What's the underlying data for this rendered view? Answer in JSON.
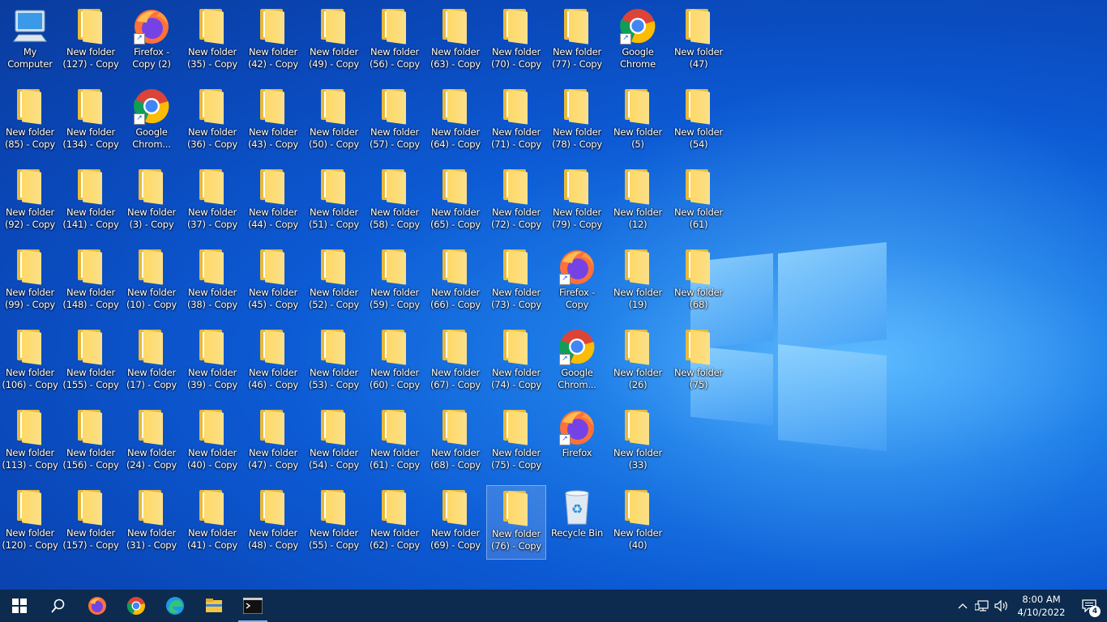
{
  "desktop": {
    "columns": [
      [
        {
          "label": "My\nComputer",
          "type": "computer"
        },
        {
          "label": "New folder\n(85) - Copy",
          "type": "folder"
        },
        {
          "label": "New folder\n(92) - Copy",
          "type": "folder"
        },
        {
          "label": "New folder\n(99) - Copy",
          "type": "folder"
        },
        {
          "label": "New folder\n(106) - Copy",
          "type": "folder"
        },
        {
          "label": "New folder\n(113) - Copy",
          "type": "folder"
        },
        {
          "label": "New folder\n(120) - Copy",
          "type": "folder"
        }
      ],
      [
        {
          "label": "New folder\n(127) - Copy",
          "type": "folder"
        },
        {
          "label": "New folder\n(134) - Copy",
          "type": "folder"
        },
        {
          "label": "New folder\n(141) - Copy",
          "type": "folder"
        },
        {
          "label": "New folder\n(148) - Copy",
          "type": "folder"
        },
        {
          "label": "New folder\n(155) - Copy",
          "type": "folder"
        },
        {
          "label": "New folder\n(156) - Copy",
          "type": "folder"
        },
        {
          "label": "New folder\n(157) - Copy",
          "type": "folder"
        }
      ],
      [
        {
          "label": "Firefox -\nCopy (2)",
          "type": "firefox"
        },
        {
          "label": "Google\nChrom...",
          "type": "chrome"
        },
        {
          "label": "New folder\n(3) - Copy",
          "type": "folder"
        },
        {
          "label": "New folder\n(10) - Copy",
          "type": "folder"
        },
        {
          "label": "New folder\n(17) - Copy",
          "type": "folder"
        },
        {
          "label": "New folder\n(24) - Copy",
          "type": "folder"
        },
        {
          "label": "New folder\n(31) - Copy",
          "type": "folder"
        }
      ],
      [
        {
          "label": "New folder\n(35) - Copy",
          "type": "folder"
        },
        {
          "label": "New folder\n(36) - Copy",
          "type": "folder"
        },
        {
          "label": "New folder\n(37) - Copy",
          "type": "folder"
        },
        {
          "label": "New folder\n(38) - Copy",
          "type": "folder"
        },
        {
          "label": "New folder\n(39) - Copy",
          "type": "folder"
        },
        {
          "label": "New folder\n(40) - Copy",
          "type": "folder"
        },
        {
          "label": "New folder\n(41) - Copy",
          "type": "folder"
        }
      ],
      [
        {
          "label": "New folder\n(42) - Copy",
          "type": "folder"
        },
        {
          "label": "New folder\n(43) - Copy",
          "type": "folder"
        },
        {
          "label": "New folder\n(44) - Copy",
          "type": "folder"
        },
        {
          "label": "New folder\n(45) - Copy",
          "type": "folder"
        },
        {
          "label": "New folder\n(46) - Copy",
          "type": "folder"
        },
        {
          "label": "New folder\n(47) - Copy",
          "type": "folder"
        },
        {
          "label": "New folder\n(48) - Copy",
          "type": "folder"
        }
      ],
      [
        {
          "label": "New folder\n(49) - Copy",
          "type": "folder"
        },
        {
          "label": "New folder\n(50) - Copy",
          "type": "folder"
        },
        {
          "label": "New folder\n(51) - Copy",
          "type": "folder"
        },
        {
          "label": "New folder\n(52) - Copy",
          "type": "folder"
        },
        {
          "label": "New folder\n(53) - Copy",
          "type": "folder"
        },
        {
          "label": "New folder\n(54) - Copy",
          "type": "folder"
        },
        {
          "label": "New folder\n(55) - Copy",
          "type": "folder"
        }
      ],
      [
        {
          "label": "New folder\n(56) - Copy",
          "type": "folder"
        },
        {
          "label": "New folder\n(57) - Copy",
          "type": "folder"
        },
        {
          "label": "New folder\n(58) - Copy",
          "type": "folder"
        },
        {
          "label": "New folder\n(59) - Copy",
          "type": "folder"
        },
        {
          "label": "New folder\n(60) - Copy",
          "type": "folder"
        },
        {
          "label": "New folder\n(61) - Copy",
          "type": "folder"
        },
        {
          "label": "New folder\n(62) - Copy",
          "type": "folder"
        }
      ],
      [
        {
          "label": "New folder\n(63) - Copy",
          "type": "folder"
        },
        {
          "label": "New folder\n(64) - Copy",
          "type": "folder"
        },
        {
          "label": "New folder\n(65) - Copy",
          "type": "folder"
        },
        {
          "label": "New folder\n(66) - Copy",
          "type": "folder"
        },
        {
          "label": "New folder\n(67) - Copy",
          "type": "folder"
        },
        {
          "label": "New folder\n(68) - Copy",
          "type": "folder"
        },
        {
          "label": "New folder\n(69) - Copy",
          "type": "folder"
        }
      ],
      [
        {
          "label": "New folder\n(70) - Copy",
          "type": "folder"
        },
        {
          "label": "New folder\n(71) - Copy",
          "type": "folder"
        },
        {
          "label": "New folder\n(72) - Copy",
          "type": "folder"
        },
        {
          "label": "New folder\n(73) - Copy",
          "type": "folder"
        },
        {
          "label": "New folder\n(74) - Copy",
          "type": "folder"
        },
        {
          "label": "New folder\n(75) - Copy",
          "type": "folder"
        },
        {
          "label": "New folder\n(76) - Copy",
          "type": "folder",
          "selected": true
        }
      ],
      [
        {
          "label": "New folder\n(77) - Copy",
          "type": "folder"
        },
        {
          "label": "New folder\n(78) - Copy",
          "type": "folder"
        },
        {
          "label": "New folder\n(79) - Copy",
          "type": "folder"
        },
        {
          "label": "Firefox -\nCopy",
          "type": "firefox"
        },
        {
          "label": "Google\nChrom...",
          "type": "chrome"
        },
        {
          "label": "Firefox",
          "type": "firefox"
        },
        {
          "label": "Recycle Bin",
          "type": "recycle"
        }
      ],
      [
        {
          "label": "Google\nChrome",
          "type": "chrome"
        },
        {
          "label": "New folder\n(5)",
          "type": "folder"
        },
        {
          "label": "New folder\n(12)",
          "type": "folder"
        },
        {
          "label": "New folder\n(19)",
          "type": "folder"
        },
        {
          "label": "New folder\n(26)",
          "type": "folder"
        },
        {
          "label": "New folder\n(33)",
          "type": "folder"
        },
        {
          "label": "New folder\n(40)",
          "type": "folder"
        }
      ],
      [
        {
          "label": "New folder\n(47)",
          "type": "folder"
        },
        {
          "label": "New folder\n(54)",
          "type": "folder"
        },
        {
          "label": "New folder\n(61)",
          "type": "folder"
        },
        {
          "label": "New folder\n(68)",
          "type": "folder"
        },
        {
          "label": "New folder\n(75)",
          "type": "folder"
        }
      ]
    ]
  },
  "taskbar": {
    "items": [
      {
        "icon": "windows-start-icon"
      },
      {
        "icon": "search-icon"
      },
      {
        "icon": "firefox-icon"
      },
      {
        "icon": "chrome-icon"
      },
      {
        "icon": "edge-icon"
      },
      {
        "icon": "file-explorer-icon"
      },
      {
        "icon": "terminal-icon",
        "active": true
      }
    ],
    "clock_time": "8:00 AM",
    "clock_date": "4/10/2022",
    "notification_count": "4"
  }
}
